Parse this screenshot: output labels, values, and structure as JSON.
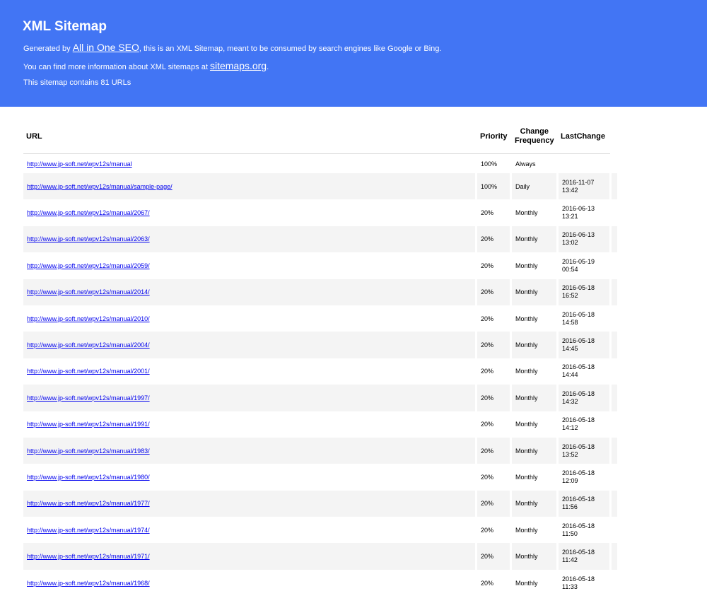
{
  "header": {
    "title": "XML Sitemap",
    "intro_before": "Generated by ",
    "intro_link": "All in One SEO",
    "intro_after": ", this is an XML Sitemap, meant to be consumed by search engines like Google or Bing.",
    "info_before": "You can find more information about XML sitemaps at ",
    "info_link": "sitemaps.org",
    "info_after": ".",
    "count_text": "This sitemap contains 81 URLs",
    "bg_color": "#4275f4"
  },
  "table": {
    "columns": {
      "url": "URL",
      "priority": "Priority",
      "change_line1": "Change",
      "change_line2": "Frequency",
      "last": "LastChange"
    },
    "rows": [
      {
        "url": "http://www.jp-soft.net/wpv12s/manual",
        "priority": "100%",
        "freq": "Always",
        "date": "",
        "time": ""
      },
      {
        "url": "http://www.jp-soft.net/wpv12s/manual/sample-page/",
        "priority": "100%",
        "freq": "Daily",
        "date": "2016-11-07",
        "time": "13:42"
      },
      {
        "url": "http://www.jp-soft.net/wpv12s/manual/2067/",
        "priority": "20%",
        "freq": "Monthly",
        "date": "2016-06-13",
        "time": "13:21"
      },
      {
        "url": "http://www.jp-soft.net/wpv12s/manual/2063/",
        "priority": "20%",
        "freq": "Monthly",
        "date": "2016-06-13",
        "time": "13:02"
      },
      {
        "url": "http://www.jp-soft.net/wpv12s/manual/2059/",
        "priority": "20%",
        "freq": "Monthly",
        "date": "2016-05-19",
        "time": "00:54"
      },
      {
        "url": "http://www.jp-soft.net/wpv12s/manual/2014/",
        "priority": "20%",
        "freq": "Monthly",
        "date": "2016-05-18",
        "time": "16:52"
      },
      {
        "url": "http://www.jp-soft.net/wpv12s/manual/2010/",
        "priority": "20%",
        "freq": "Monthly",
        "date": "2016-05-18",
        "time": "14:58"
      },
      {
        "url": "http://www.jp-soft.net/wpv12s/manual/2004/",
        "priority": "20%",
        "freq": "Monthly",
        "date": "2016-05-18",
        "time": "14:45"
      },
      {
        "url": "http://www.jp-soft.net/wpv12s/manual/2001/",
        "priority": "20%",
        "freq": "Monthly",
        "date": "2016-05-18",
        "time": "14:44"
      },
      {
        "url": "http://www.jp-soft.net/wpv12s/manual/1997/",
        "priority": "20%",
        "freq": "Monthly",
        "date": "2016-05-18",
        "time": "14:32"
      },
      {
        "url": "http://www.jp-soft.net/wpv12s/manual/1991/",
        "priority": "20%",
        "freq": "Monthly",
        "date": "2016-05-18",
        "time": "14:12"
      },
      {
        "url": "http://www.jp-soft.net/wpv12s/manual/1983/",
        "priority": "20%",
        "freq": "Monthly",
        "date": "2016-05-18",
        "time": "13:52"
      },
      {
        "url": "http://www.jp-soft.net/wpv12s/manual/1980/",
        "priority": "20%",
        "freq": "Monthly",
        "date": "2016-05-18",
        "time": "12:09"
      },
      {
        "url": "http://www.jp-soft.net/wpv12s/manual/1977/",
        "priority": "20%",
        "freq": "Monthly",
        "date": "2016-05-18",
        "time": "11:56"
      },
      {
        "url": "http://www.jp-soft.net/wpv12s/manual/1974/",
        "priority": "20%",
        "freq": "Monthly",
        "date": "2016-05-18",
        "time": "11:50"
      },
      {
        "url": "http://www.jp-soft.net/wpv12s/manual/1971/",
        "priority": "20%",
        "freq": "Monthly",
        "date": "2016-05-18",
        "time": "11:42"
      },
      {
        "url": "http://www.jp-soft.net/wpv12s/manual/1968/",
        "priority": "20%",
        "freq": "Monthly",
        "date": "2016-05-18",
        "time": "11:33"
      }
    ]
  }
}
